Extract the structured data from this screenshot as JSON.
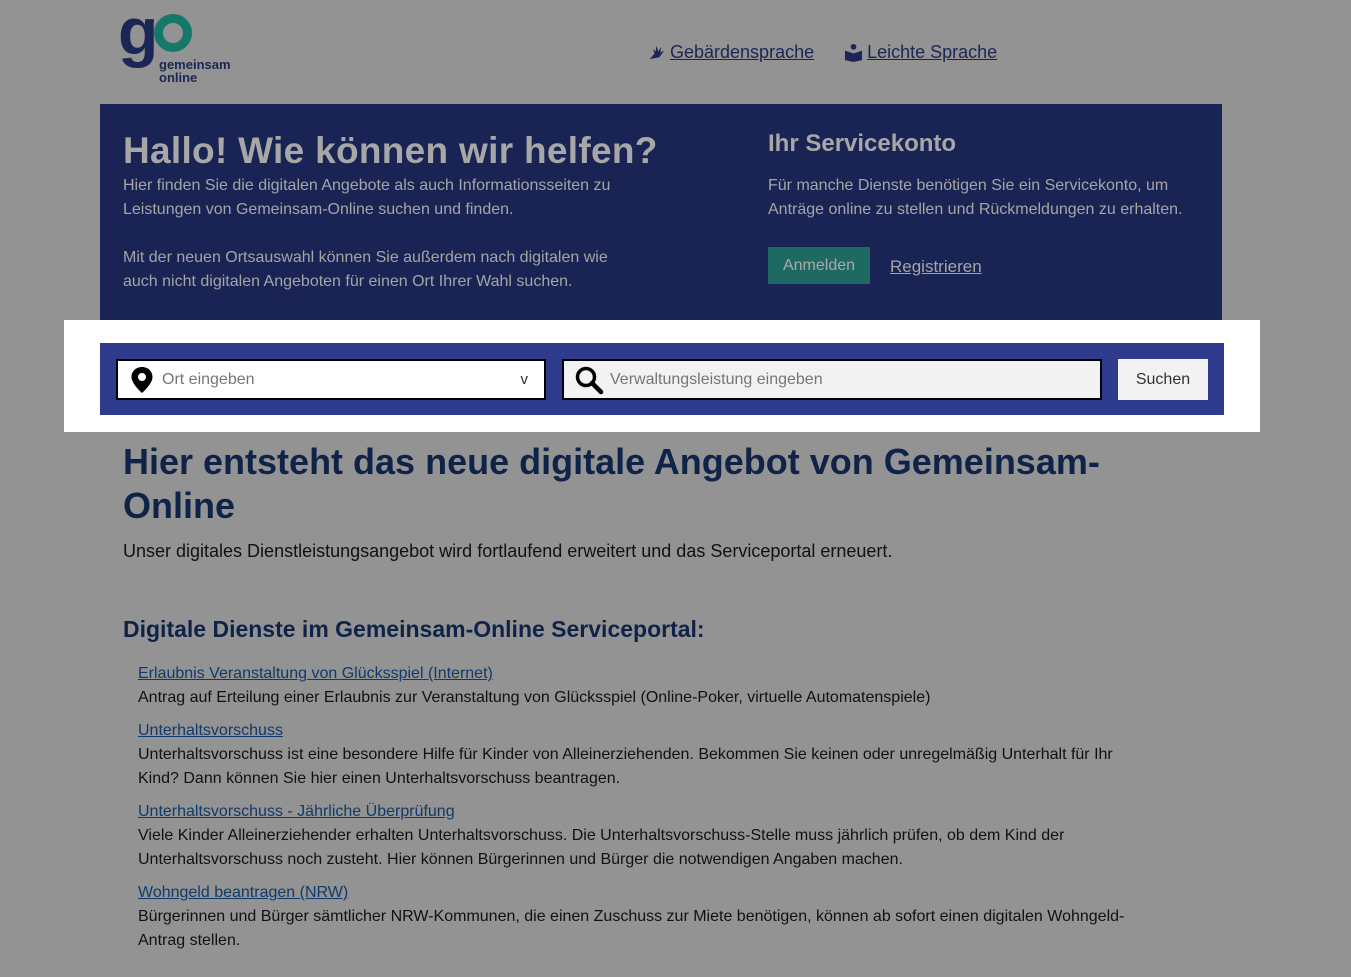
{
  "brand": {
    "logo_line1": "gemeinsam",
    "logo_line2": "online"
  },
  "toplinks": [
    {
      "label": "Gebärdensprache",
      "icon": "sign-language-hands-icon"
    },
    {
      "label": "Leichte Sprache",
      "icon": "easy-language-book-icon"
    }
  ],
  "hero": {
    "title": "Hallo! Wie können wir helfen?",
    "p1": "Hier finden Sie die digitalen Angebote als auch Informationsseiten zu Leistungen von Gemeinsam-Online suchen und finden.",
    "p2": "Mit der neuen Ortsauswahl können Sie außerdem nach digitalen wie auch nicht digitalen Angeboten für einen Ort Ihrer Wahl suchen."
  },
  "servicekonto": {
    "title": "Ihr Servicekonto",
    "text": "Für manche Dienste benötigen Sie ein Servicekonto, um Anträge online zu stellen und Rückmeldungen zu erhalten.",
    "login_label": "Anmelden",
    "register_label": "Registrieren"
  },
  "search": {
    "location_placeholder": "Ort eingeben",
    "location_chevron": "v",
    "service_placeholder": "Verwaltungsleistung eingeben",
    "button_label": "Suchen"
  },
  "main": {
    "title": "Hier entsteht das neue digitale Angebot von Gemeinsam-Online",
    "subtitle": "Unser digitales Dienstleistungsangebot wird fortlaufend erweitert und das Serviceportal erneuert.",
    "section_title": "Digitale Dienste im Gemeinsam-Online Serviceportal:",
    "services": [
      {
        "title": "Erlaubnis Veranstaltung von Glücksspiel (Internet)",
        "description": "Antrag auf Erteilung einer Erlaubnis zur Veranstaltung von Glücksspiel (Online-Poker, virtuelle Automatenspiele)"
      },
      {
        "title": "Unterhaltsvorschuss",
        "description": "Unterhaltsvorschuss ist eine besondere Hilfe für Kinder von Alleinerziehenden. Bekommen Sie keinen oder unregelmäßig Unterhalt für Ihr Kind? Dann können Sie hier einen Unterhaltsvorschuss beantragen."
      },
      {
        "title": "Unterhaltsvorschuss - Jährliche Überprüfung",
        "description": "Viele Kinder Alleinerziehender erhalten Unterhaltsvorschuss. Die Unterhaltsvorschuss-Stelle muss jährlich prüfen, ob dem Kind der Unterhaltsvorschuss noch zusteht. Hier können Bürgerinnen und Bürger die notwendigen Angaben machen."
      },
      {
        "title": "Wohngeld beantragen (NRW)",
        "description": "Bürgerinnen und Bürger sämtlicher NRW-Kommunen, die einen Zuschuss zur Miete benötigen, können ab sofort einen digitalen Wohngeld-Antrag stellen."
      }
    ]
  },
  "colors": {
    "overlay_background": "#939393",
    "hero_background": "#1a2454",
    "search_bar": "#2e3a8c",
    "login_button": "#1e6a62",
    "title_text": "#0f2348"
  }
}
